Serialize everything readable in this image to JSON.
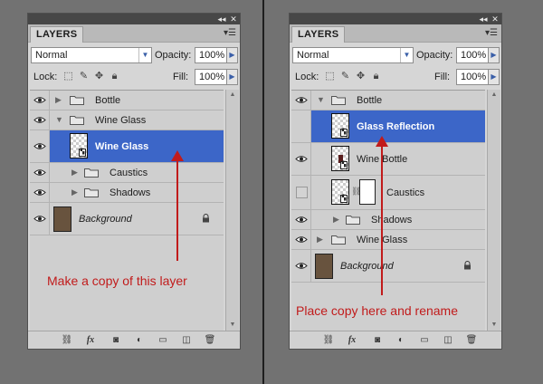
{
  "colors": {
    "selection": "#3c66c8",
    "annotation": "#c11b1b",
    "background_swatch": "#68533e"
  },
  "panels": [
    {
      "tab": "LAYERS",
      "blend_mode": "Normal",
      "opacity_label": "Opacity:",
      "opacity_value": "100%",
      "lock_label": "Lock:",
      "fill_label": "Fill:",
      "fill_value": "100%",
      "layers": [
        {
          "name": "Bottle",
          "type": "group",
          "visible": true,
          "expanded": false
        },
        {
          "name": "Wine Glass",
          "type": "group",
          "visible": true,
          "expanded": true
        },
        {
          "name": "Wine Glass",
          "type": "layer",
          "visible": true,
          "selected": true
        },
        {
          "name": "Caustics",
          "type": "group",
          "visible": true,
          "expanded": false
        },
        {
          "name": "Shadows",
          "type": "group",
          "visible": true,
          "expanded": false
        },
        {
          "name": "Background",
          "type": "background",
          "visible": true,
          "locked": true
        }
      ],
      "annotation": "Make a copy of this layer"
    },
    {
      "tab": "LAYERS",
      "blend_mode": "Normal",
      "opacity_label": "Opacity:",
      "opacity_value": "100%",
      "lock_label": "Lock:",
      "fill_label": "Fill:",
      "fill_value": "100%",
      "layers": [
        {
          "name": "Bottle",
          "type": "group",
          "visible": true,
          "expanded": true
        },
        {
          "name": "Glass Reflection",
          "type": "layer",
          "visible": true,
          "selected": true
        },
        {
          "name": "Wine Bottle",
          "type": "layer",
          "visible": true
        },
        {
          "name": "Caustics",
          "type": "layer",
          "visible": false,
          "has_mask": true
        },
        {
          "name": "Shadows",
          "type": "group",
          "visible": true,
          "expanded": false
        },
        {
          "name": "Wine Glass",
          "type": "group",
          "visible": true,
          "expanded": false
        },
        {
          "name": "Background",
          "type": "background",
          "visible": true,
          "locked": true
        }
      ],
      "annotation": "Place copy here and rename"
    }
  ]
}
